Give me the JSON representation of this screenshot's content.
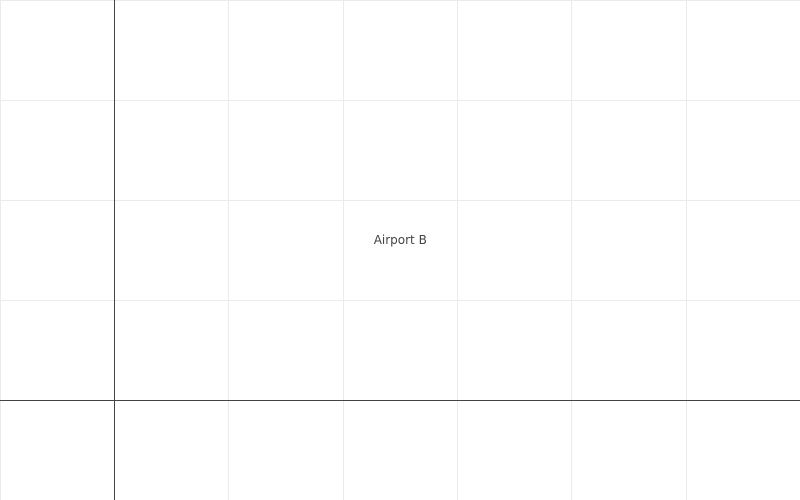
{
  "chart_data": {
    "type": "scatter",
    "title": "",
    "xlabel": "",
    "ylabel": "",
    "grid": true,
    "legend": "none",
    "x_grid": [
      -1,
      0,
      1,
      2,
      3,
      4,
      5,
      6
    ],
    "y_grid": [
      -1,
      0,
      1,
      2,
      3,
      4,
      5
    ],
    "points": [
      {
        "x": 2.5,
        "y": 1.6,
        "label": "Airport B",
        "marker_visible": false
      }
    ]
  },
  "colors": {
    "grid": "#ebebeb",
    "axis": "#444444",
    "label": "#444444",
    "background": "#ffffff"
  }
}
